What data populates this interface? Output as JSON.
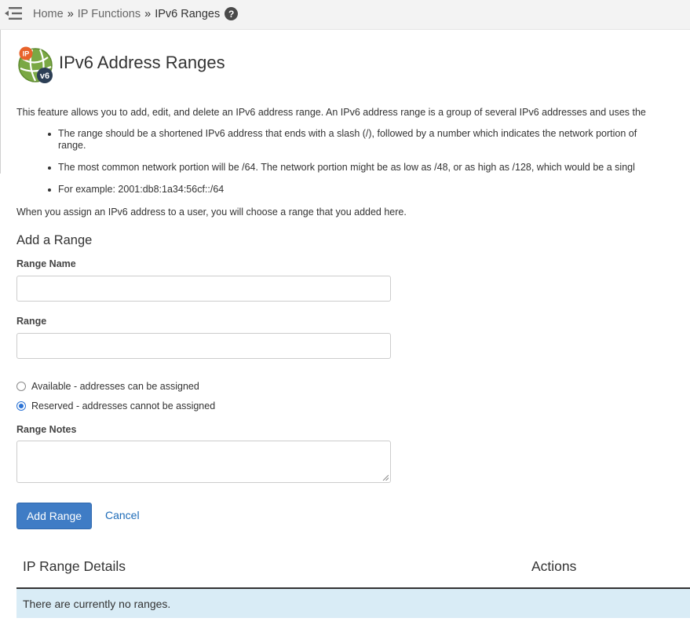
{
  "breadcrumb": {
    "home": "Home",
    "separator": "»",
    "section": "IP Functions",
    "current": "IPv6 Ranges",
    "help_glyph": "?"
  },
  "icons": {
    "menu": "menu-toggle-icon",
    "help": "question-circle-icon",
    "header": "ipv6-globe-icon",
    "header_badge_ip": "IP",
    "header_badge_v6": "v6"
  },
  "header": {
    "title": "IPv6 Address Ranges"
  },
  "description": "This feature allows you to add, edit, and delete an IPv6 address range. An IPv6 address range is a group of several IPv6 addresses and uses the",
  "bullets": [
    {
      "text": "The range should be a shortened IPv6 address that ends with a slash (/), followed by a number which indicates the network portion of",
      "continuation": "range."
    },
    {
      "text": "The most common network portion will be /64. The network portion might be as low as /48, or as high as /128, which would be a singl"
    },
    {
      "text": "For example: 2001:db8:1a34:56cf::/64"
    }
  ],
  "assign_note": "When you assign an IPv6 address to a user, you will choose a range that you added here.",
  "form": {
    "section_title": "Add a Range",
    "range_name_label": "Range Name",
    "range_name_value": "",
    "range_label": "Range",
    "range_value": "",
    "radio_options": [
      {
        "label": "Available - addresses can be assigned",
        "checked": false
      },
      {
        "label": "Reserved - addresses cannot be assigned",
        "checked": true
      }
    ],
    "notes_label": "Range Notes",
    "notes_value": "",
    "submit_label": "Add Range",
    "cancel_label": "Cancel"
  },
  "table": {
    "columns": [
      "IP Range Details",
      "Actions"
    ],
    "empty_message": "There are currently no ranges."
  },
  "colors": {
    "primary_button": "#3f7cc5",
    "link": "#1d6bb8",
    "empty_row_bg": "#d9ecf6",
    "topbar_bg": "#f3f3f3",
    "radio_checked": "#2a72d5"
  }
}
